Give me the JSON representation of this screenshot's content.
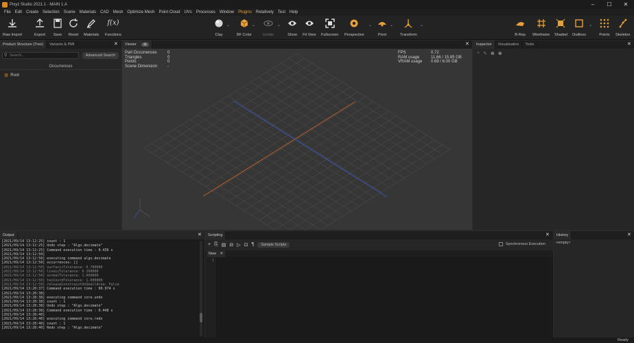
{
  "window": {
    "title": "Pixyz Studio 2021.1 - MAIN 1.A",
    "minimize": "–",
    "maximize": "☐",
    "close": "✕"
  },
  "menu": [
    {
      "label": "File"
    },
    {
      "label": "Edit"
    },
    {
      "label": "Create"
    },
    {
      "label": "Selection"
    },
    {
      "label": "Scene"
    },
    {
      "label": "Materials"
    },
    {
      "label": "CAD"
    },
    {
      "label": "Mesh"
    },
    {
      "label": "Optimize Mesh"
    },
    {
      "label": "Point Cloud"
    },
    {
      "label": "UVs"
    },
    {
      "label": "Processes"
    },
    {
      "label": "Window"
    },
    {
      "label": "Plugins"
    },
    {
      "label": "Relatively"
    },
    {
      "label": "Test"
    },
    {
      "label": "Help"
    }
  ],
  "toolbar": {
    "raw_import": "Raw Import",
    "export": "Export",
    "save": "Save",
    "reset": "Reset",
    "materials": "Materials",
    "functions": "Functions",
    "functions_glyph": "f(x)",
    "clay": "Clay",
    "bf_color": "BF Color",
    "isolate": "Isolate",
    "show": "Show",
    "fit_view": "Fit View",
    "fullscreen": "Fullscreen",
    "perspective": "Perspective",
    "pivot": "Pivot",
    "transform": "Transform",
    "brep": "B-Rep",
    "wireframe": "Wireframe",
    "shaded": "Shaded",
    "outlines": "Outlines",
    "points": "Points",
    "skeleton": "Skeleton",
    "caret": "⌄"
  },
  "left_panel": {
    "tabs": [
      "Product Structure (Tree)",
      "Variants & PMI"
    ],
    "close": "✕",
    "search_placeholder": "Search...",
    "advanced_search": "Advanced Search",
    "header": "Occurrences",
    "root": "Root"
  },
  "viewer": {
    "tab": "Viewer",
    "tab_badge": "⊞",
    "close": "✕",
    "stats": [
      {
        "k": "Part Occurrences",
        "v": "0"
      },
      {
        "k": "Triangles",
        "v": "0"
      },
      {
        "k": "Points",
        "v": "0"
      },
      {
        "k": "Scene Dimension",
        "v": "-"
      }
    ],
    "perf": [
      {
        "k": "FPS",
        "v": "0.72"
      },
      {
        "k": "RAM usage",
        "v": "11.66 / 15.85 GB"
      },
      {
        "k": "VRAM usage",
        "v": "0.69 / 6.00 GB"
      }
    ]
  },
  "right_panel": {
    "tabs": [
      "Inspector",
      "Visualization",
      "Tools"
    ],
    "close": "✕",
    "icons": [
      "+",
      "✎",
      "⊕",
      "⊗"
    ]
  },
  "output": {
    "tab": "Output",
    "close": "✕",
    "lines": [
      "[2021/09/14 13:12:25] count : 1",
      "[2021/09/14 13:12:25] Undo step : \"Algo.decimate\"",
      "[2021/09/14 13:12:25] Command execution time : 0.436 s",
      "[2021/09/14 13:12:50]",
      "[2021/09/14 13:12:50] executing command algo.decimate",
      "[2021/09/14 13:12:50] occurrences: []",
      "[2021/09/14 13:12:50] surfacicTolerance: 0.700000",
      "[2021/09/14 13:12:50] lineicTolerance: 0.100000",
      "[2021/09/14 13:12:50] normalTolerance: 1.000000",
      "[2021/09/14 13:12:50] texCoordTolerance: 1.000000",
      "[2021/09/14 13:12:50] releaseConstraintOnSmallArea: False",
      "[2021/09/14 13:20:37] Command execution time : 60.974 s",
      "[2021/09/14 13:20:38]",
      "[2021/09/14 13:28:38] executing command core.undo",
      "[2021/09/14 13:28:38] count : 1",
      "[2021/09/14 13:28:38] Undo step : \"Algo.decimate\"",
      "[2021/09/14 13:28:38] Command execution time : 0.448 s",
      "[2021/09/14 13:28:40]",
      "[2021/09/14 13:28:40] executing command core.redo",
      "[2021/09/14 13:28:40] count : 1",
      "[2021/09/14 13:28:40] Redo step : \"Algo.decimate\""
    ]
  },
  "scripting": {
    "tab": "Scripting",
    "close": "✕",
    "tools": [
      "+",
      "⎘",
      "▤",
      "⊟",
      "▷",
      "⊡",
      "¶"
    ],
    "sample_scripts": "Sample Scripts",
    "sync_execution": "Synchronous Execution",
    "file_tab": "New",
    "file_tab_close": "✕",
    "line_number": "1"
  },
  "history": {
    "tab": "History",
    "close": "✕",
    "empty": "<empty>"
  },
  "status": "Ready",
  "colors": {
    "accent": "#e8a13a",
    "x_axis": "#c0622a",
    "y_axis": "#3d56b0"
  }
}
